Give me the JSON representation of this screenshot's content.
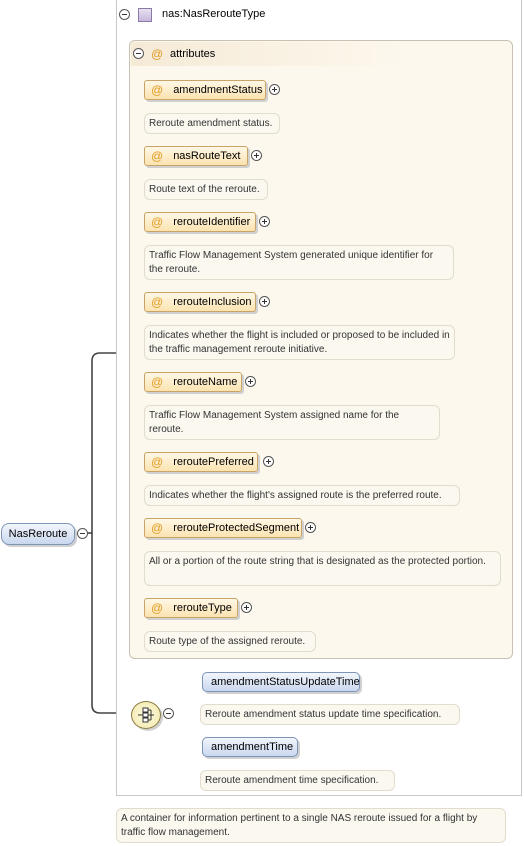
{
  "root": {
    "label": "NasReroute"
  },
  "type": {
    "label": "nas:NasRerouteType"
  },
  "attributes_group": {
    "label": "attributes",
    "at_symbol": "@"
  },
  "attributes": [
    {
      "name": "amendmentStatus",
      "description": "Reroute amendment status."
    },
    {
      "name": "nasRouteText",
      "description": "Route text of the reroute."
    },
    {
      "name": "rerouteIdentifier",
      "description": "Traffic Flow Management System generated unique identifier for the reroute."
    },
    {
      "name": "rerouteInclusion",
      "description": "Indicates whether the flight is included or proposed to be included in the traffic management reroute initiative."
    },
    {
      "name": "rerouteName",
      "description": "Traffic Flow Management System assigned name for the reroute."
    },
    {
      "name": "reroutePreferred",
      "description": "Indicates whether the flight's assigned route is the preferred route."
    },
    {
      "name": "rerouteProtectedSegment",
      "description": "All or a portion of the route string that is designated as the protected portion."
    },
    {
      "name": "rerouteType",
      "description": "Route type of the assigned reroute."
    }
  ],
  "elements": [
    {
      "name": "amendmentStatusUpdateTime",
      "description": "Reroute amendment status update time specification."
    },
    {
      "name": "amendmentTime",
      "description": "Reroute amendment time specification."
    }
  ],
  "footer": {
    "description": "A container for information pertinent to a single NAS reroute issued for a flight by traffic flow management."
  },
  "icons": {
    "collapse": "collapse-icon",
    "expand": "expand-icon",
    "type": "complex-type-icon",
    "sequence": "sequence-compositor-icon"
  },
  "colors": {
    "attribute_fill": "#fbe3b0",
    "element_fill": "#c9d7ee",
    "attribute_at": "#e09a20"
  }
}
